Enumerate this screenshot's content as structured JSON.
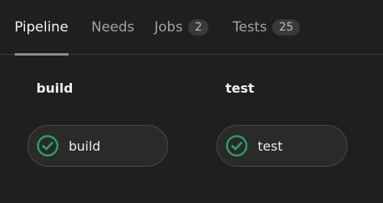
{
  "tabs": [
    {
      "label": "Pipeline",
      "active": true
    },
    {
      "label": "Needs"
    },
    {
      "label": "Jobs",
      "count": "2"
    },
    {
      "label": "Tests",
      "count": "25"
    }
  ],
  "stages": [
    {
      "title": "build",
      "jobs": [
        {
          "name": "build",
          "status": "passed",
          "status_icon": "check-circle-icon"
        }
      ]
    },
    {
      "title": "test",
      "jobs": [
        {
          "name": "test",
          "status": "passed",
          "status_icon": "check-circle-icon"
        }
      ]
    }
  ],
  "colors": {
    "background": "#1f1f1f",
    "success": "#2da160",
    "tab_indicator": "#8d8d8d"
  }
}
